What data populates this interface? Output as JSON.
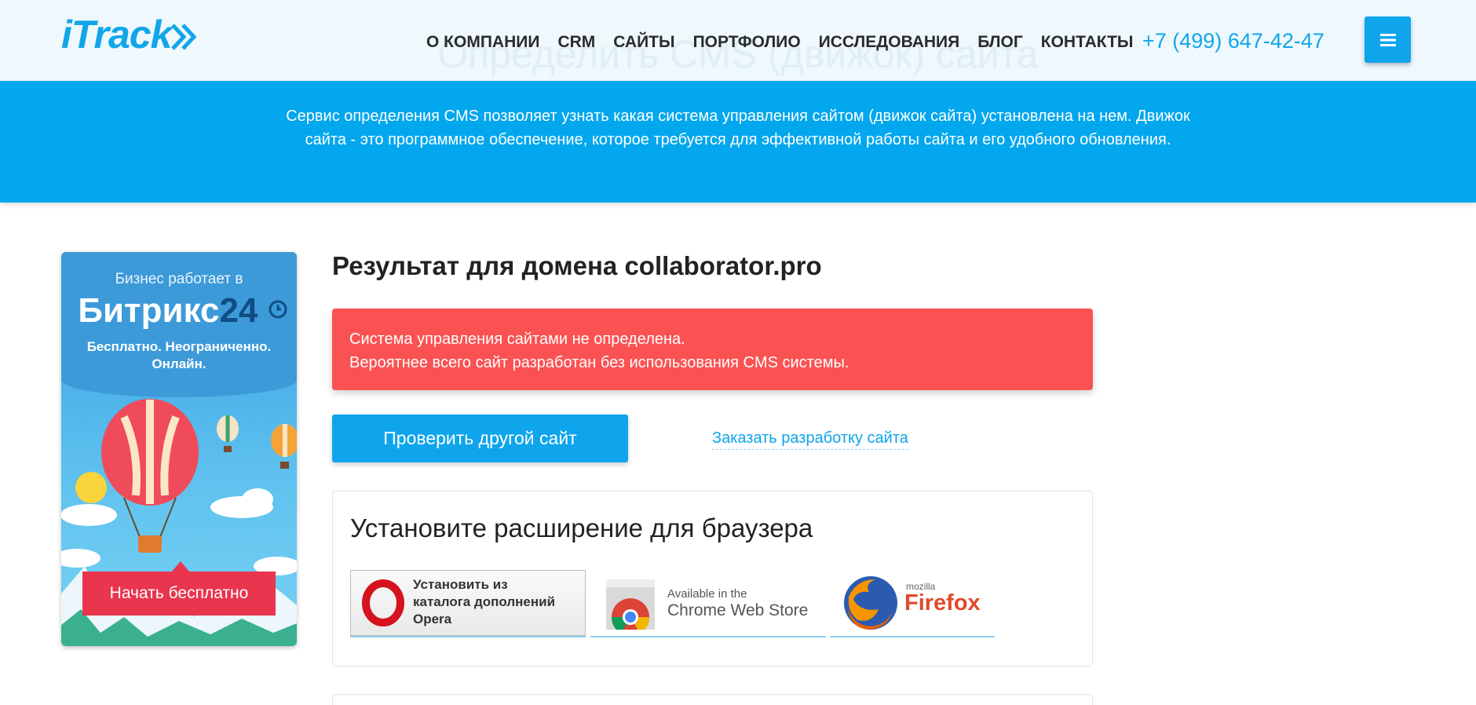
{
  "header": {
    "logo_text": "iTrack",
    "ghost_title": "Определить CMS (движок) сайта",
    "nav": [
      "О КОМПАНИИ",
      "CRM",
      "САЙТЫ",
      "ПОРТФОЛИО",
      "ИССЛЕДОВАНИЯ",
      "БЛОГ",
      "КОНТАКТЫ"
    ],
    "phone": "+7 (499) 647-42-47"
  },
  "banner": {
    "text": "Сервис определения CMS позволяет узнать какая система управления сайтом (движок сайта) установлена на нем. Движок сайта - это программное обеспечение, которое требуется для эффективной работы сайта и его удобного обновления."
  },
  "ad": {
    "line1": "Бизнес работает в",
    "brand": "Битрикс",
    "brand_num": "24",
    "sub1": "Бесплатно. Неограниченно.",
    "sub2": "Онлайн.",
    "cta": "Начать бесплатно"
  },
  "result": {
    "title": "Результат для домена collaborator.pro",
    "alert_line1": "Система управления сайтами не определена.",
    "alert_line2": "Вероятнее всего сайт разработан без использования CMS системы.",
    "check_button": "Проверить другой сайт",
    "order_link": "Заказать разработку сайта"
  },
  "extensions": {
    "title": "Установите расширение для браузера",
    "opera_line1": "Установить из",
    "opera_line2": "каталога дополнений",
    "opera_line3": "Opera",
    "chrome_line1": "Available in the",
    "chrome_line2": "Chrome Web Store",
    "firefox_line1": "mozilla",
    "firefox_line2": "Firefox"
  },
  "colors": {
    "accent": "#0ea5ec",
    "banner": "#02a7ed",
    "alert": "#fa5252",
    "header_bg": "#eef8fd"
  }
}
